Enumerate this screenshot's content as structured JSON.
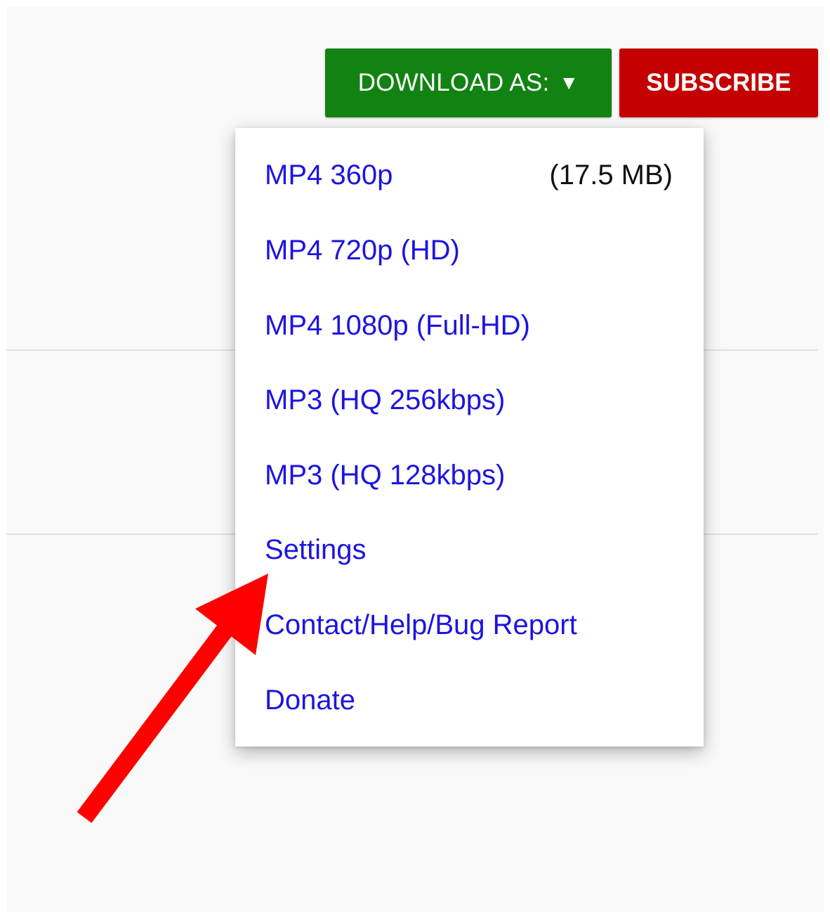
{
  "header": {
    "download_label": "DOWNLOAD AS:",
    "download_caret": "▼",
    "subscribe_label": "SUBSCRIBE"
  },
  "menu": {
    "items": [
      {
        "label": "MP4 360p",
        "size": "(17.5 MB)"
      },
      {
        "label": "MP4 720p (HD)"
      },
      {
        "label": "MP4 1080p (Full-HD)"
      },
      {
        "label": "MP3 (HQ 256kbps)"
      },
      {
        "label": "MP3 (HQ 128kbps)"
      },
      {
        "label": "Settings"
      },
      {
        "label": "Contact/Help/Bug Report"
      },
      {
        "label": "Donate"
      }
    ]
  },
  "annotation": {
    "icon": "red-arrow-icon",
    "points_to": "Settings",
    "color": "#ff0000"
  },
  "colors": {
    "download_button": "#128312",
    "subscribe_button": "#c40000",
    "link_text": "#1d14e0"
  }
}
